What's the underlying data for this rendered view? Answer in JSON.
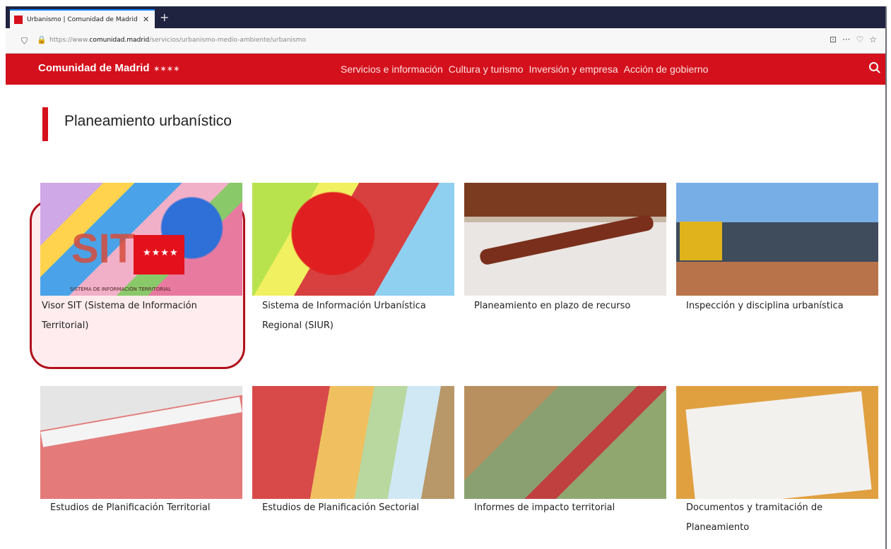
{
  "browser": {
    "tab_title": "Urbanismo | Comunidad de Madrid",
    "tab_close": "✕",
    "new_tab": "+",
    "url_prefix": "https://www.",
    "url_domain": "comunidad.madrid",
    "url_path": "/servicios/urbanismo-medio-ambiente/urbanismo",
    "url_actions": [
      "⊡",
      "···",
      "♡",
      "☆"
    ]
  },
  "header": {
    "logo": "Comunidad de Madrid",
    "logo_stars": "✶✶✶✶",
    "nav": [
      {
        "label": "Servicios e información"
      },
      {
        "label": "Cultura y turismo"
      },
      {
        "label": "Inversión y empresa"
      },
      {
        "label": "Acción de gobierno"
      }
    ]
  },
  "page": {
    "title": "Planeamiento urbanístico"
  },
  "cards": [
    {
      "label": "Visor SIT (Sistema de Información Territorial)",
      "overlay_text": "SIT",
      "flag_stars": "★★★★",
      "caption": "SISTEMA DE INFORMACIÓN TERRITORIAL"
    },
    {
      "label": "Sistema de Información Urbanística Regional (SIUR)"
    },
    {
      "label": "Planeamiento en plazo de recurso"
    },
    {
      "label": "Inspección y disciplina urbanística"
    },
    {
      "label": "Estudios de Planificación Territorial"
    },
    {
      "label": "Estudios de Planificación Sectorial"
    },
    {
      "label": "Informes de impacto territorial"
    },
    {
      "label": "Documentos y tramitación de Planeamiento"
    }
  ],
  "colors": {
    "brand_red": "#d4101c",
    "tabbar": "#202340",
    "highlight": "#b0101a"
  }
}
